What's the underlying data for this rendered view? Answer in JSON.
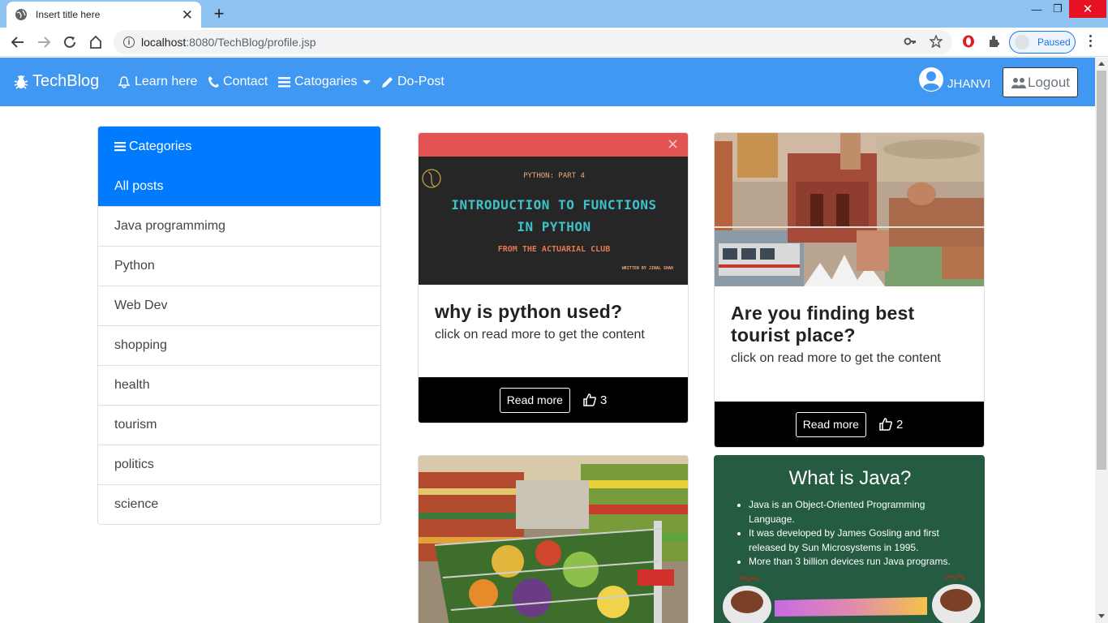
{
  "browser": {
    "tab_title": "Insert title here",
    "url_host": "localhost",
    "url_path": ":8080/TechBlog/profile.jsp",
    "profile_status": "Paused"
  },
  "navbar": {
    "brand": "TechBlog",
    "links": {
      "learn": "Learn here",
      "contact": "Contact",
      "categories": "Catogaries",
      "post": "Do-Post"
    },
    "username": "JHANVI",
    "logout": "Logout",
    "color": "#4198f2"
  },
  "sidebar": {
    "header": "Categories",
    "items": [
      "All posts",
      "Java programmimg",
      "Python",
      "Web Dev",
      "shopping",
      "health",
      "tourism",
      "politics",
      "science"
    ],
    "accent": "#007bff"
  },
  "posts": [
    {
      "title": "why is python used?",
      "text": "click on read more to get the content",
      "read_more": "Read more",
      "likes": "3",
      "image": {
        "part": "PYTHON: PART 4",
        "line1": "INTRODUCTION TO FUNCTIONS",
        "line2": "IN PYTHON",
        "source": "FROM THE ACTUARIAL CLUB",
        "credit": "WRITTEN BY JINAL SHAH"
      }
    },
    {
      "title": "Are you finding best tourist place?",
      "text": "click on read more to get the content",
      "read_more": "Read more",
      "likes": "2"
    },
    {
      "image": "shopping-cart-photo"
    },
    {
      "image": {
        "heading": "What is Java?",
        "bullets": [
          "Java is an Object-Oriented Programming Language.",
          "It was developed by James Gosling and first released by Sun Microsystems in 1995.",
          "More than 3 billion devices run Java programs."
        ]
      }
    }
  ]
}
